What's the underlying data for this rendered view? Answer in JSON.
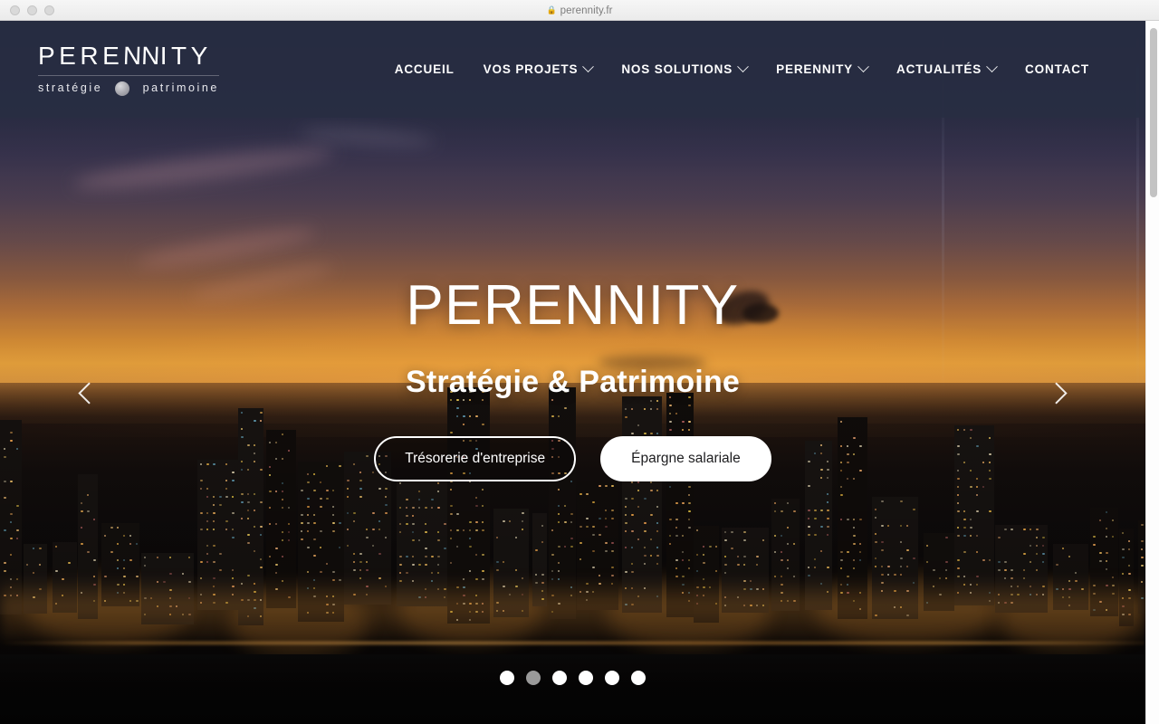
{
  "browser": {
    "url": "perennity.fr",
    "lock_icon": "lock-icon",
    "traffic_lights": [
      "close",
      "minimize",
      "zoom"
    ]
  },
  "header": {
    "logo": {
      "word": "PERENNITY",
      "word_part_a": "PERE",
      "word_part_nn": "NN",
      "word_part_b": "ITY",
      "tagline_left": "stratégie",
      "tagline_right": "patrimoine",
      "separator_icon": "circle-icon"
    },
    "nav": [
      {
        "label": "ACCUEIL",
        "has_dropdown": false
      },
      {
        "label": "VOS PROJETS",
        "has_dropdown": true
      },
      {
        "label": "NOS SOLUTIONS",
        "has_dropdown": true
      },
      {
        "label": "PERENNITY",
        "has_dropdown": true
      },
      {
        "label": "ACTUALITÉS",
        "has_dropdown": true
      },
      {
        "label": "CONTACT",
        "has_dropdown": false
      }
    ]
  },
  "hero": {
    "title": "PERENNITY",
    "subtitle": "Stratégie & Patrimoine",
    "buttons": [
      {
        "label": "Trésorerie d'entreprise",
        "style": "outline"
      },
      {
        "label": "Épargne salariale",
        "style": "solid"
      }
    ],
    "prev_arrow_icon": "chevron-left-icon",
    "next_arrow_icon": "chevron-right-icon",
    "carousel": {
      "slide_count": 6,
      "active_index": 1
    }
  },
  "colors": {
    "header_bg": "#282d42",
    "dot_inactive": "#ffffff",
    "dot_active": "#9a9a9a",
    "button_solid_bg": "#ffffff",
    "button_solid_text": "#1d1d1f",
    "text_white": "#ffffff"
  }
}
